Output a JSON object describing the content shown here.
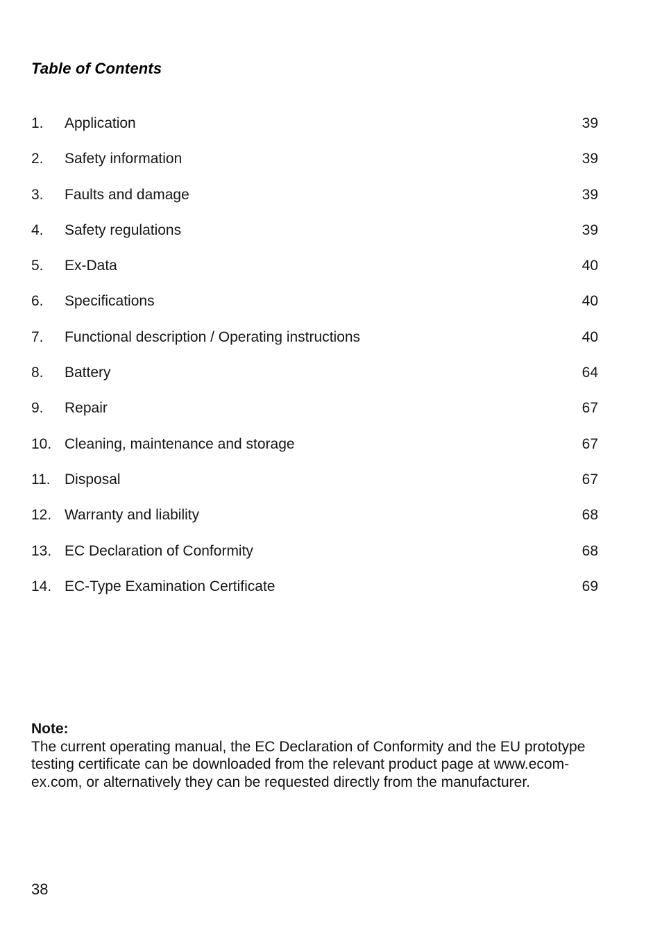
{
  "document": {
    "title": "Table of Contents",
    "toc": [
      {
        "number": "1.",
        "label": "Application",
        "page": "39"
      },
      {
        "number": "2.",
        "label": "Safety information",
        "page": "39"
      },
      {
        "number": "3.",
        "label": "Faults and damage",
        "page": "39"
      },
      {
        "number": "4.",
        "label": "Safety regulations",
        "page": "39"
      },
      {
        "number": "5.",
        "label": "Ex-Data",
        "page": "40"
      },
      {
        "number": "6.",
        "label": "Specifications",
        "page": "40"
      },
      {
        "number": "7.",
        "label": "Functional description / Operating instructions",
        "page": "40"
      },
      {
        "number": "8.",
        "label": "Battery",
        "page": "64"
      },
      {
        "number": "9.",
        "label": "Repair",
        "page": "67"
      },
      {
        "number": "10.",
        "label": "Cleaning, maintenance and storage",
        "page": "67"
      },
      {
        "number": "11.",
        "label": "Disposal",
        "page": "67"
      },
      {
        "number": "12.",
        "label": "Warranty and liability",
        "page": "68"
      },
      {
        "number": "13.",
        "label": "EC Declaration of Conformity",
        "page": "68"
      },
      {
        "number": "14.",
        "label": "EC-Type Examination Certificate",
        "page": "69"
      }
    ],
    "note": {
      "heading": "Note:",
      "body": "The current operating manual, the EC Declaration of Conformity and the EU prototype testing certificate can be downloaded from the relevant product page at www.ecom-ex.com, or alternatively they can be requested directly from the manufacturer."
    },
    "page_number": "38"
  }
}
